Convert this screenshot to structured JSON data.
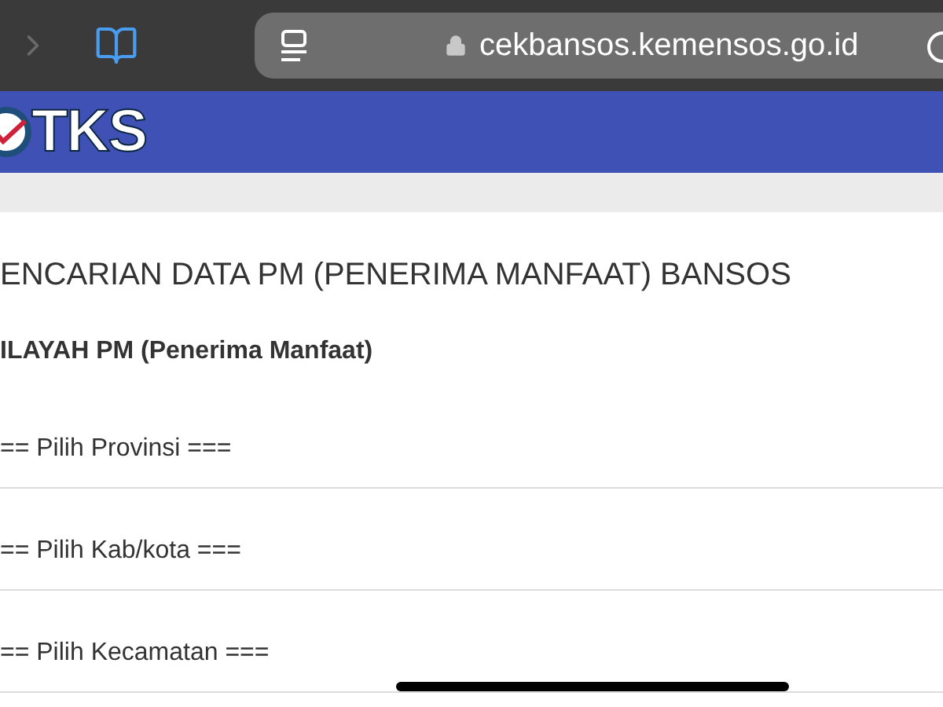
{
  "browser": {
    "url": "cekbansos.kemensos.go.id"
  },
  "header": {
    "logo_text": "TKS"
  },
  "page": {
    "title": "ENCARIAN DATA PM (PENERIMA MANFAAT) BANSOS",
    "section_title": "ILAYAH PM (Penerima Manfaat)",
    "selects": [
      {
        "placeholder": "== Pilih Provinsi ==="
      },
      {
        "placeholder": "== Pilih Kab/kota ==="
      },
      {
        "placeholder": "== Pilih Kecamatan ==="
      }
    ]
  }
}
